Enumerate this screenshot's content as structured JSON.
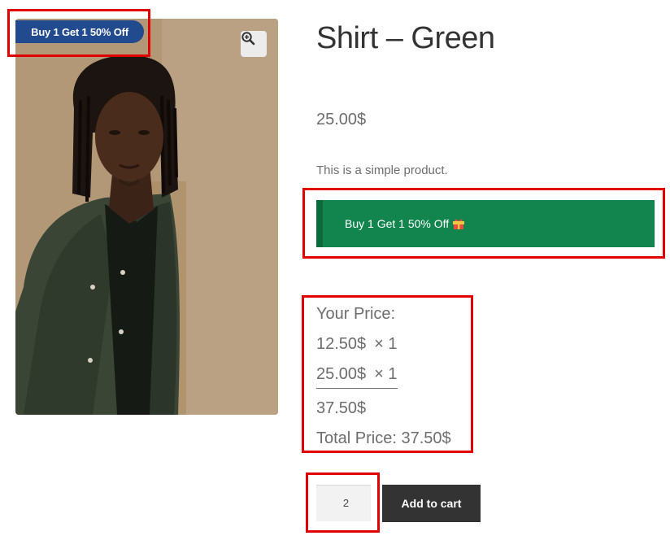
{
  "product": {
    "title": "Shirt – Green",
    "price": "25.00$",
    "description": "This is a simple product.",
    "sale_badge": "Buy 1 Get 1 50% Off",
    "image_alt": "Man wearing a green shirt",
    "zoom_icon": "zoom-in-icon"
  },
  "offer": {
    "text": "Buy 1 Get 1 50% Off",
    "icon": "gift-icon",
    "color": "#12844e"
  },
  "pricing": {
    "label": "Your Price:",
    "rows": [
      {
        "price": "12.50$",
        "qty": "× 1"
      },
      {
        "price": "25.00$",
        "qty": "× 1"
      }
    ],
    "sum": "37.50$",
    "total": "Total Price: 37.50$"
  },
  "cart": {
    "quantity": "2",
    "add_label": "Add to cart"
  },
  "colors": {
    "badge": "#224a8f",
    "annotation": "#e00000",
    "button": "#333333"
  }
}
